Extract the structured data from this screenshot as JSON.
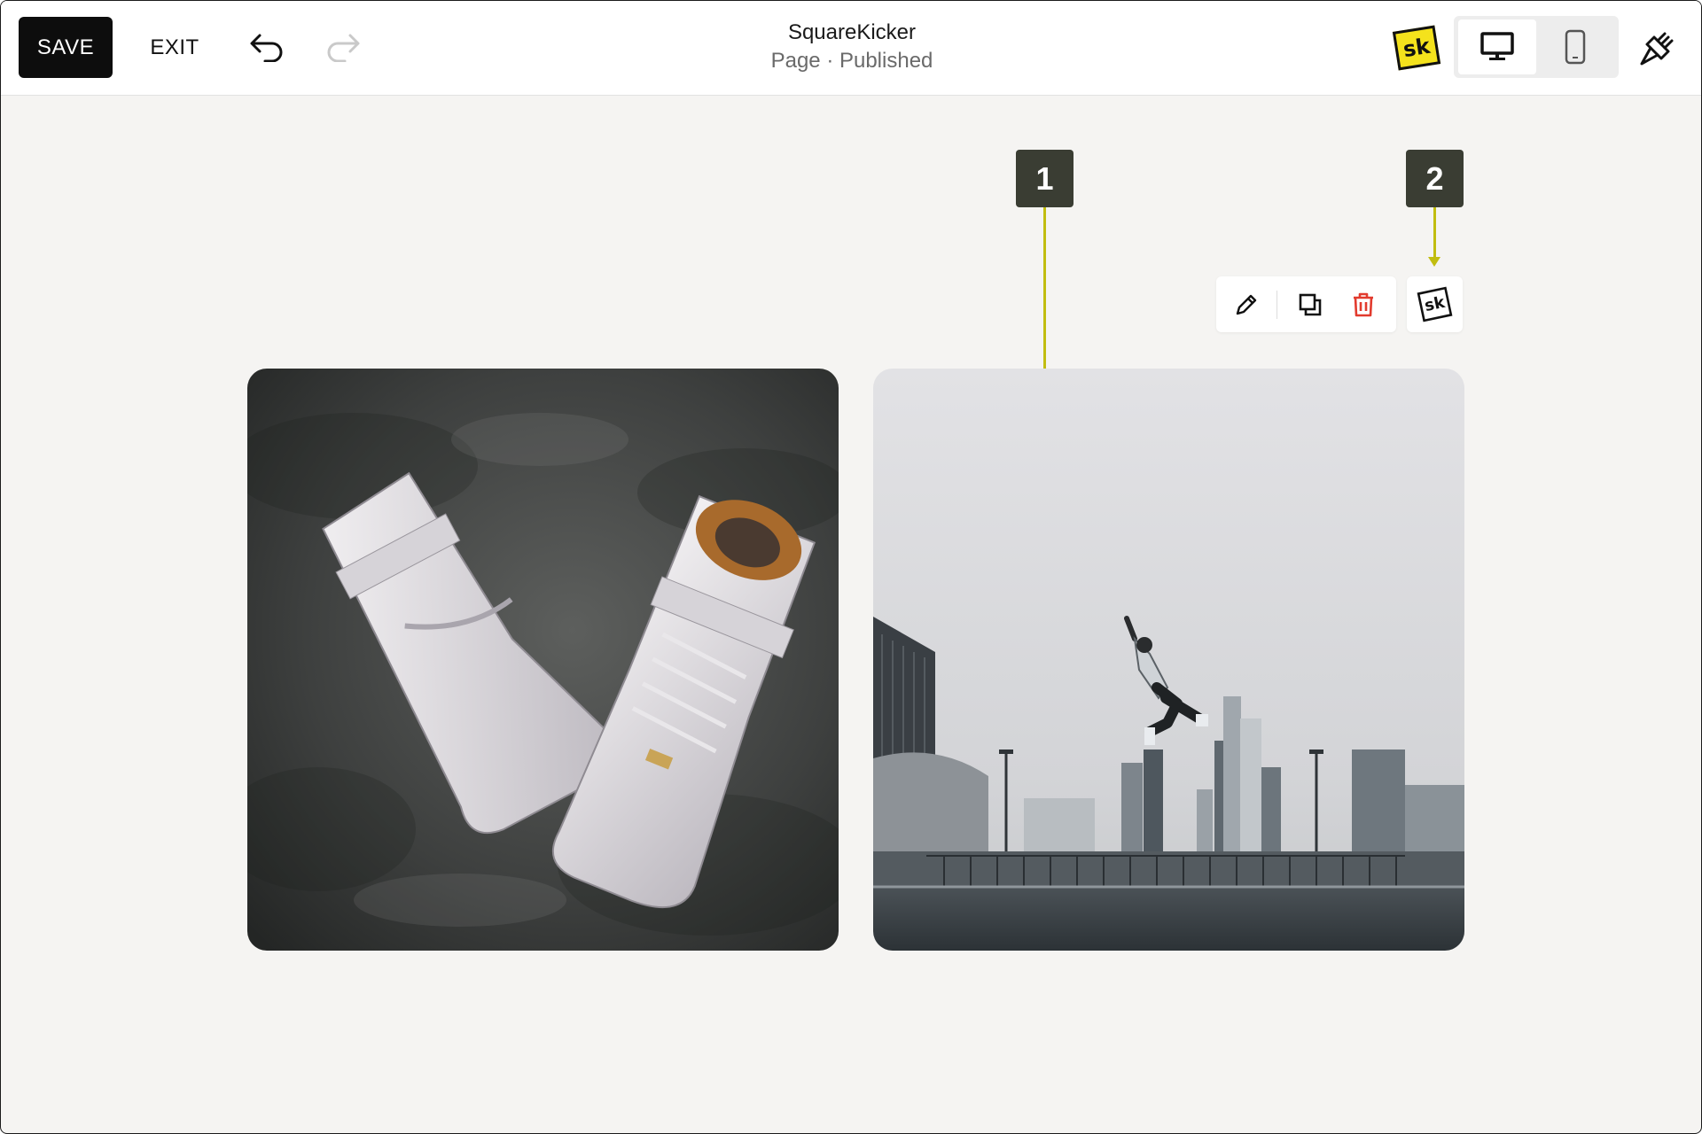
{
  "toolbar": {
    "save_label": "SAVE",
    "exit_label": "EXIT",
    "undo_icon": "undo-icon",
    "redo_icon": "redo-icon"
  },
  "header": {
    "site_name": "SquareKicker",
    "page_status": "Page · Published"
  },
  "plugin": {
    "logo_text": "sk"
  },
  "view_toggle": {
    "selected": "desktop",
    "options": [
      "desktop",
      "mobile"
    ]
  },
  "callouts": [
    {
      "number": "1"
    },
    {
      "number": "2"
    }
  ],
  "block_toolbar": {
    "items": [
      "edit-icon",
      "duplicate-icon",
      "delete-icon"
    ],
    "sk_button_text": "sk"
  },
  "images": [
    {
      "subject": "white high-top sneakers on concrete"
    },
    {
      "subject": "person jumping over city skyline"
    }
  ],
  "colors": {
    "accent": "#c1bd10",
    "callout_bg": "#3a3d33",
    "delete": "#e23b2e",
    "canvas_bg": "#f5f4f2",
    "sk_logo": "#f4e21c"
  }
}
